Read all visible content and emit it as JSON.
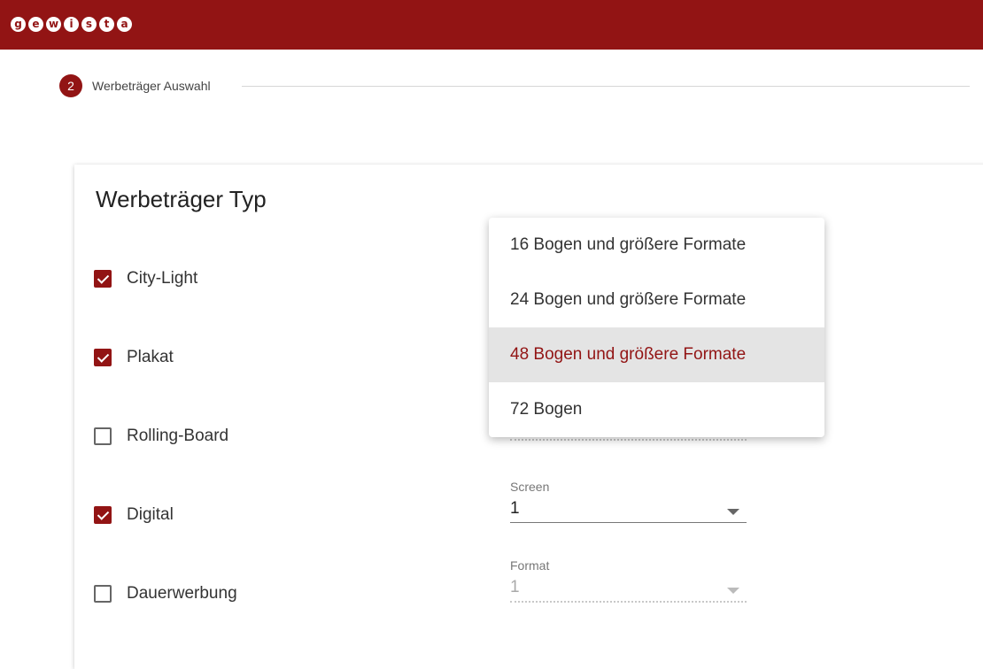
{
  "header": {
    "logo_letters": [
      "g",
      "e",
      "w",
      "i",
      "s",
      "t",
      "a"
    ],
    "brand_color": "#921414"
  },
  "stepper": {
    "number": "2",
    "label": "Werbeträger Auswahl"
  },
  "card": {
    "title": "Werbeträger Typ",
    "checkboxes": [
      {
        "label": "City-Light",
        "checked": true
      },
      {
        "label": "Plakat",
        "checked": true
      },
      {
        "label": "Rolling-Board",
        "checked": false
      },
      {
        "label": "Digital",
        "checked": true
      },
      {
        "label": "Dauerwerbung",
        "checked": false
      }
    ],
    "fields": {
      "hidden_value": "1",
      "screen": {
        "label": "Screen",
        "value": "1"
      },
      "format": {
        "label": "Format",
        "value": "1",
        "disabled": true
      }
    }
  },
  "dropdown": {
    "options": [
      {
        "label": "16 Bogen und größere Formate",
        "active": false
      },
      {
        "label": "24 Bogen und größere Formate",
        "active": false
      },
      {
        "label": "48 Bogen und größere Formate",
        "active": true
      },
      {
        "label": "72 Bogen",
        "active": false
      }
    ]
  }
}
